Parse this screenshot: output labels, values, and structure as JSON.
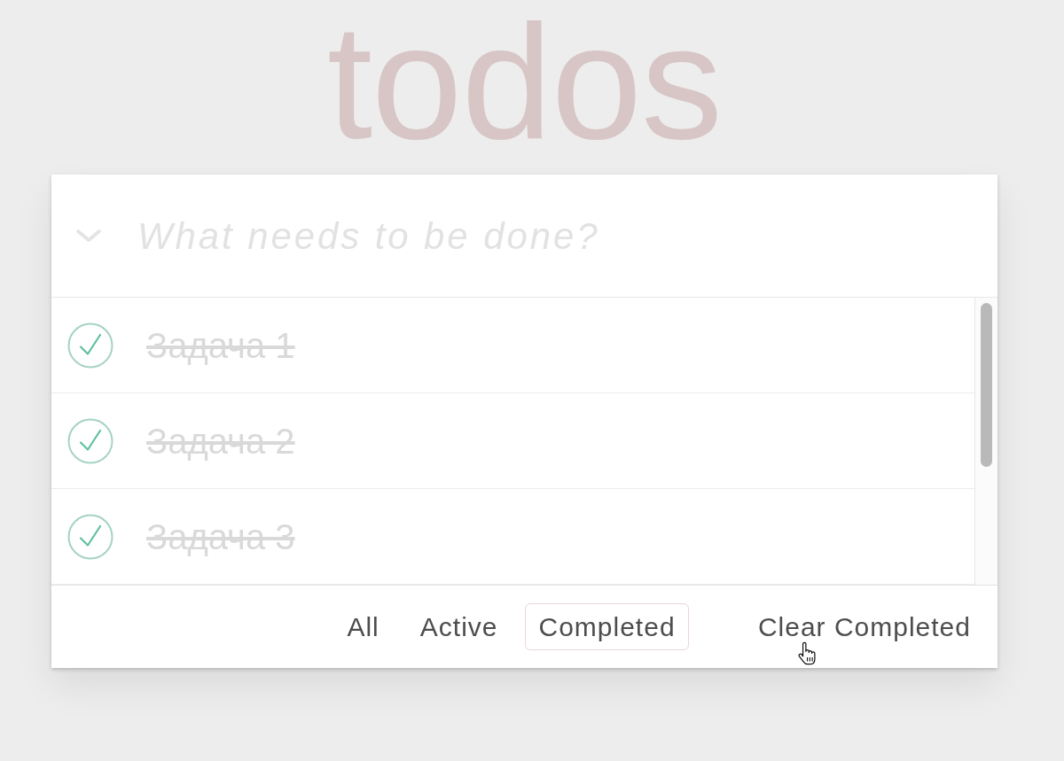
{
  "title": "todos",
  "new_todo": {
    "placeholder": "What needs to be done?"
  },
  "todos": [
    {
      "text": "Задача 1",
      "completed": true
    },
    {
      "text": "Задача 2",
      "completed": true
    },
    {
      "text": "Задача 3",
      "completed": true
    }
  ],
  "filters": [
    {
      "label": "All",
      "selected": false
    },
    {
      "label": "Active",
      "selected": false
    },
    {
      "label": "Completed",
      "selected": true
    }
  ],
  "clear_button": "Clear Completed"
}
